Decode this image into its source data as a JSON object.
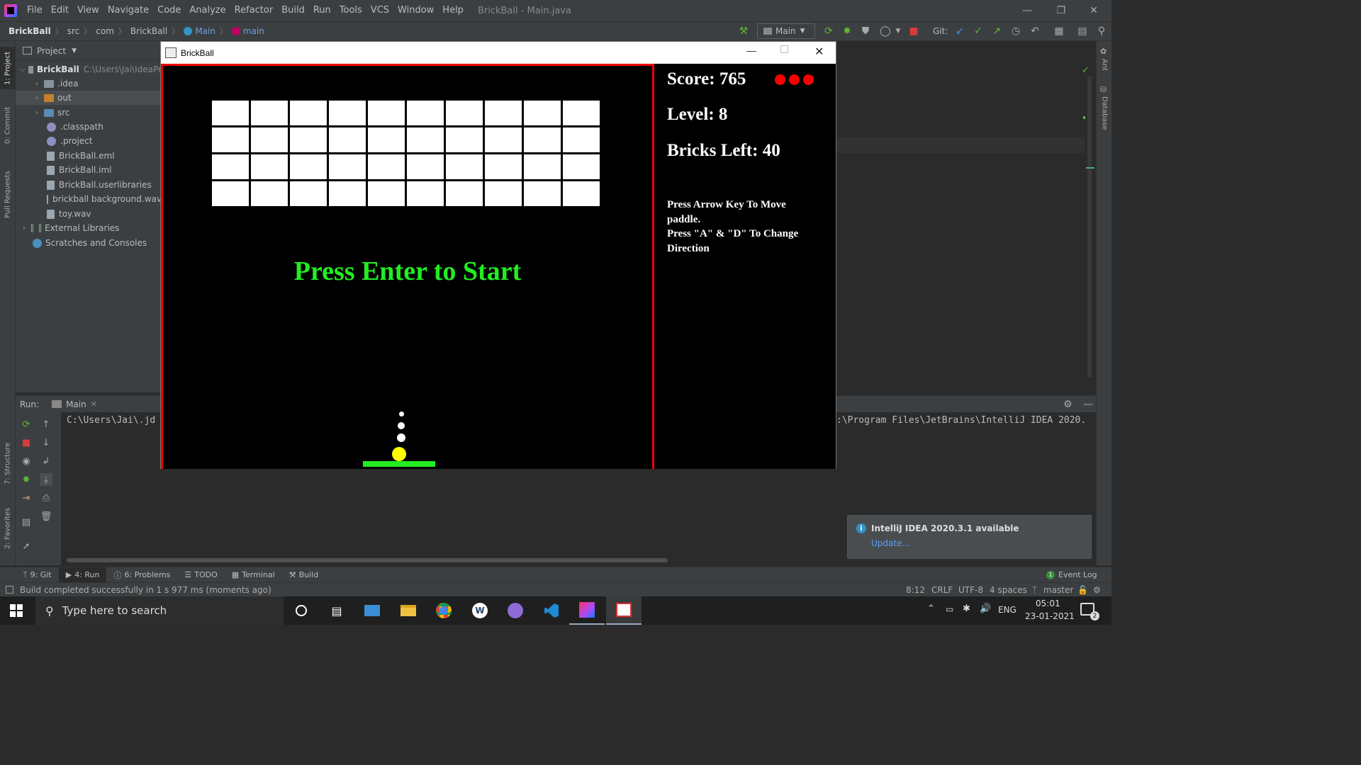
{
  "menubar": {
    "items": [
      "File",
      "Edit",
      "View",
      "Navigate",
      "Code",
      "Analyze",
      "Refactor",
      "Build",
      "Run",
      "Tools",
      "VCS",
      "Window",
      "Help"
    ],
    "window_title": "BrickBall - Main.java"
  },
  "navbar": {
    "crumbs": [
      "BrickBall",
      "src",
      "com",
      "BrickBall",
      "Main",
      "main"
    ],
    "run_config": "Main",
    "git_label": "Git:"
  },
  "left_tabs": [
    "1: Project",
    "0: Commit",
    "Pull Requests",
    "7: Structure",
    "2: Favorites"
  ],
  "right_tabs": [
    "Ant",
    "Database"
  ],
  "project": {
    "header": "Project",
    "tree": [
      {
        "label": "BrickBall",
        "path": "C:\\Users\\Jai\\IdeaPr",
        "type": "module"
      },
      {
        "label": ".idea",
        "type": "folder"
      },
      {
        "label": "out",
        "type": "folder-orange"
      },
      {
        "label": "src",
        "type": "folder-blue"
      },
      {
        "label": ".classpath",
        "type": "file"
      },
      {
        "label": ".project",
        "type": "file"
      },
      {
        "label": "BrickBall.eml",
        "type": "file"
      },
      {
        "label": "BrickBall.iml",
        "type": "file"
      },
      {
        "label": "BrickBall.userlibraries",
        "type": "file"
      },
      {
        "label": "brickball background.wav",
        "type": "file"
      },
      {
        "label": "toy.wav",
        "type": "file"
      },
      {
        "label": "External Libraries",
        "type": "lib"
      },
      {
        "label": "Scratches and Consoles",
        "type": "scratch"
      }
    ]
  },
  "run": {
    "label": "Run:",
    "tab": "Main",
    "console_left": "C:\\Users\\Jai\\.jd",
    "console_right": ":\\Program Files\\JetBrains\\IntelliJ IDEA 2020."
  },
  "bottom_tabs": [
    "9: Git",
    "4: Run",
    "6: Problems",
    "TODO",
    "Terminal",
    "Build"
  ],
  "event_log": "Event Log",
  "event_count": "1",
  "status": {
    "message": "Build completed successfully in 1 s 977 ms (moments ago)",
    "position": "8:12",
    "line_sep": "CRLF",
    "encoding": "UTF-8",
    "indent": "4 spaces",
    "branch": "master"
  },
  "notification": {
    "title": "IntelliJ IDEA 2020.3.1 available",
    "link": "Update..."
  },
  "taskbar": {
    "search_placeholder": "Type here to search",
    "lang": "ENG",
    "time": "05:01",
    "date": "23-01-2021",
    "notif_count": "2"
  },
  "game": {
    "window_title": "BrickBall",
    "score_text": "Score: 765",
    "level_text": "Level: 8",
    "bricks_text": "Bricks Left: 40",
    "lives": 3,
    "help_lines": [
      "Press Arrow Key To Move",
      "paddle.",
      "Press \"A\" & \"D\" To Change",
      "Direction"
    ],
    "start_text": "Press Enter to Start",
    "brick_rows": 4,
    "brick_cols": 10,
    "colors": {
      "border": "#ee0000",
      "start_text": "#22ee22",
      "paddle": "#22ee22",
      "ball": "#ffff00",
      "life": "#ff0000"
    }
  }
}
